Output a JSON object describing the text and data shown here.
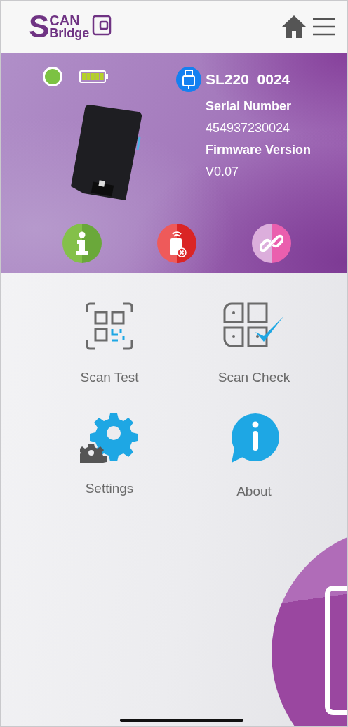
{
  "header": {
    "logo": {
      "initial": "S",
      "top": "CAN",
      "bottom": "Bridge"
    }
  },
  "device": {
    "online": true,
    "name": "SL220_0024",
    "fields": [
      {
        "kind": "label",
        "text": "Serial Number"
      },
      {
        "kind": "value",
        "text": "454937230024"
      },
      {
        "kind": "label",
        "text": "Firmware Version"
      },
      {
        "kind": "value",
        "text": "V0.07"
      }
    ]
  },
  "actions": [
    {
      "kind": "info"
    },
    {
      "kind": "disconnect"
    },
    {
      "kind": "link"
    }
  ],
  "menu": [
    {
      "kind": "scan-test",
      "label": "Scan Test"
    },
    {
      "kind": "scan-check",
      "label": "Scan Check"
    },
    {
      "kind": "settings",
      "label": "Settings"
    },
    {
      "kind": "about",
      "label": "About"
    }
  ]
}
